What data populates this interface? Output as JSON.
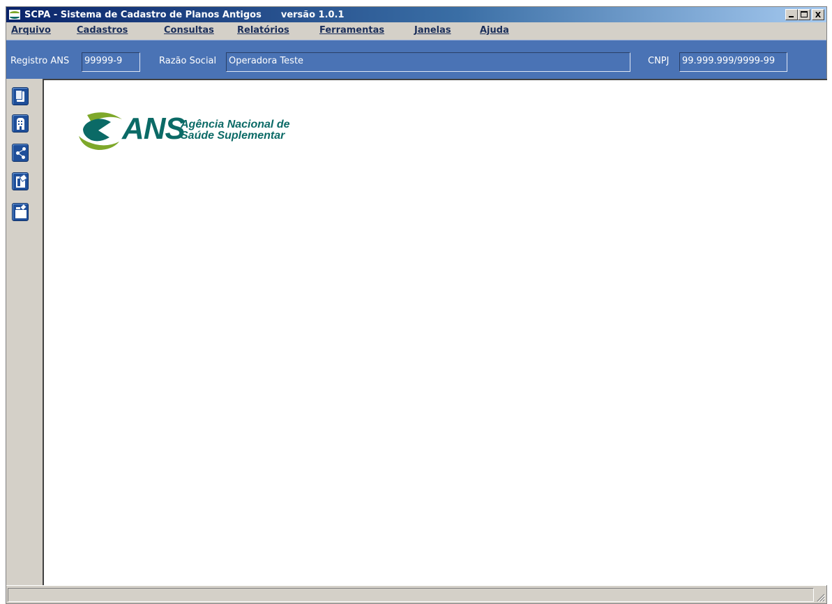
{
  "window": {
    "title": "SCPA - Sistema de Cadastro de Planos Antigos",
    "version": "versão 1.0.1",
    "controls": {
      "minimize": "_",
      "maximize": "□",
      "close": "X"
    }
  },
  "menu": [
    {
      "label": "Arquivo",
      "accel": "A"
    },
    {
      "label": "Cadastros",
      "accel": "C"
    },
    {
      "label": "Consultas",
      "accel": "C"
    },
    {
      "label": "Relatórios",
      "accel": "R"
    },
    {
      "label": "Ferramentas",
      "accel": "F"
    },
    {
      "label": "Janelas",
      "accel": "J"
    },
    {
      "label": "Ajuda",
      "accel": "u"
    }
  ],
  "infobar": {
    "registro_label": "Registro ANS",
    "registro_value": "99999-9",
    "razao_label": "Razão Social",
    "razao_value": "Operadora Teste",
    "cnpj_label": "CNPJ",
    "cnpj_value": "99.999.999/9999-99"
  },
  "toolbar": [
    {
      "icon": "document-icon"
    },
    {
      "icon": "building-icon"
    },
    {
      "icon": "network-icon"
    },
    {
      "icon": "report-icon"
    },
    {
      "icon": "exit-folder-icon"
    }
  ],
  "logo": {
    "mark": "ANS",
    "line1": "Agência Nacional de",
    "line2": "Saúde Suplementar",
    "colors": {
      "green": "#7ea82a",
      "teal": "#0b6a66"
    }
  },
  "statusbar": {
    "text": ""
  }
}
